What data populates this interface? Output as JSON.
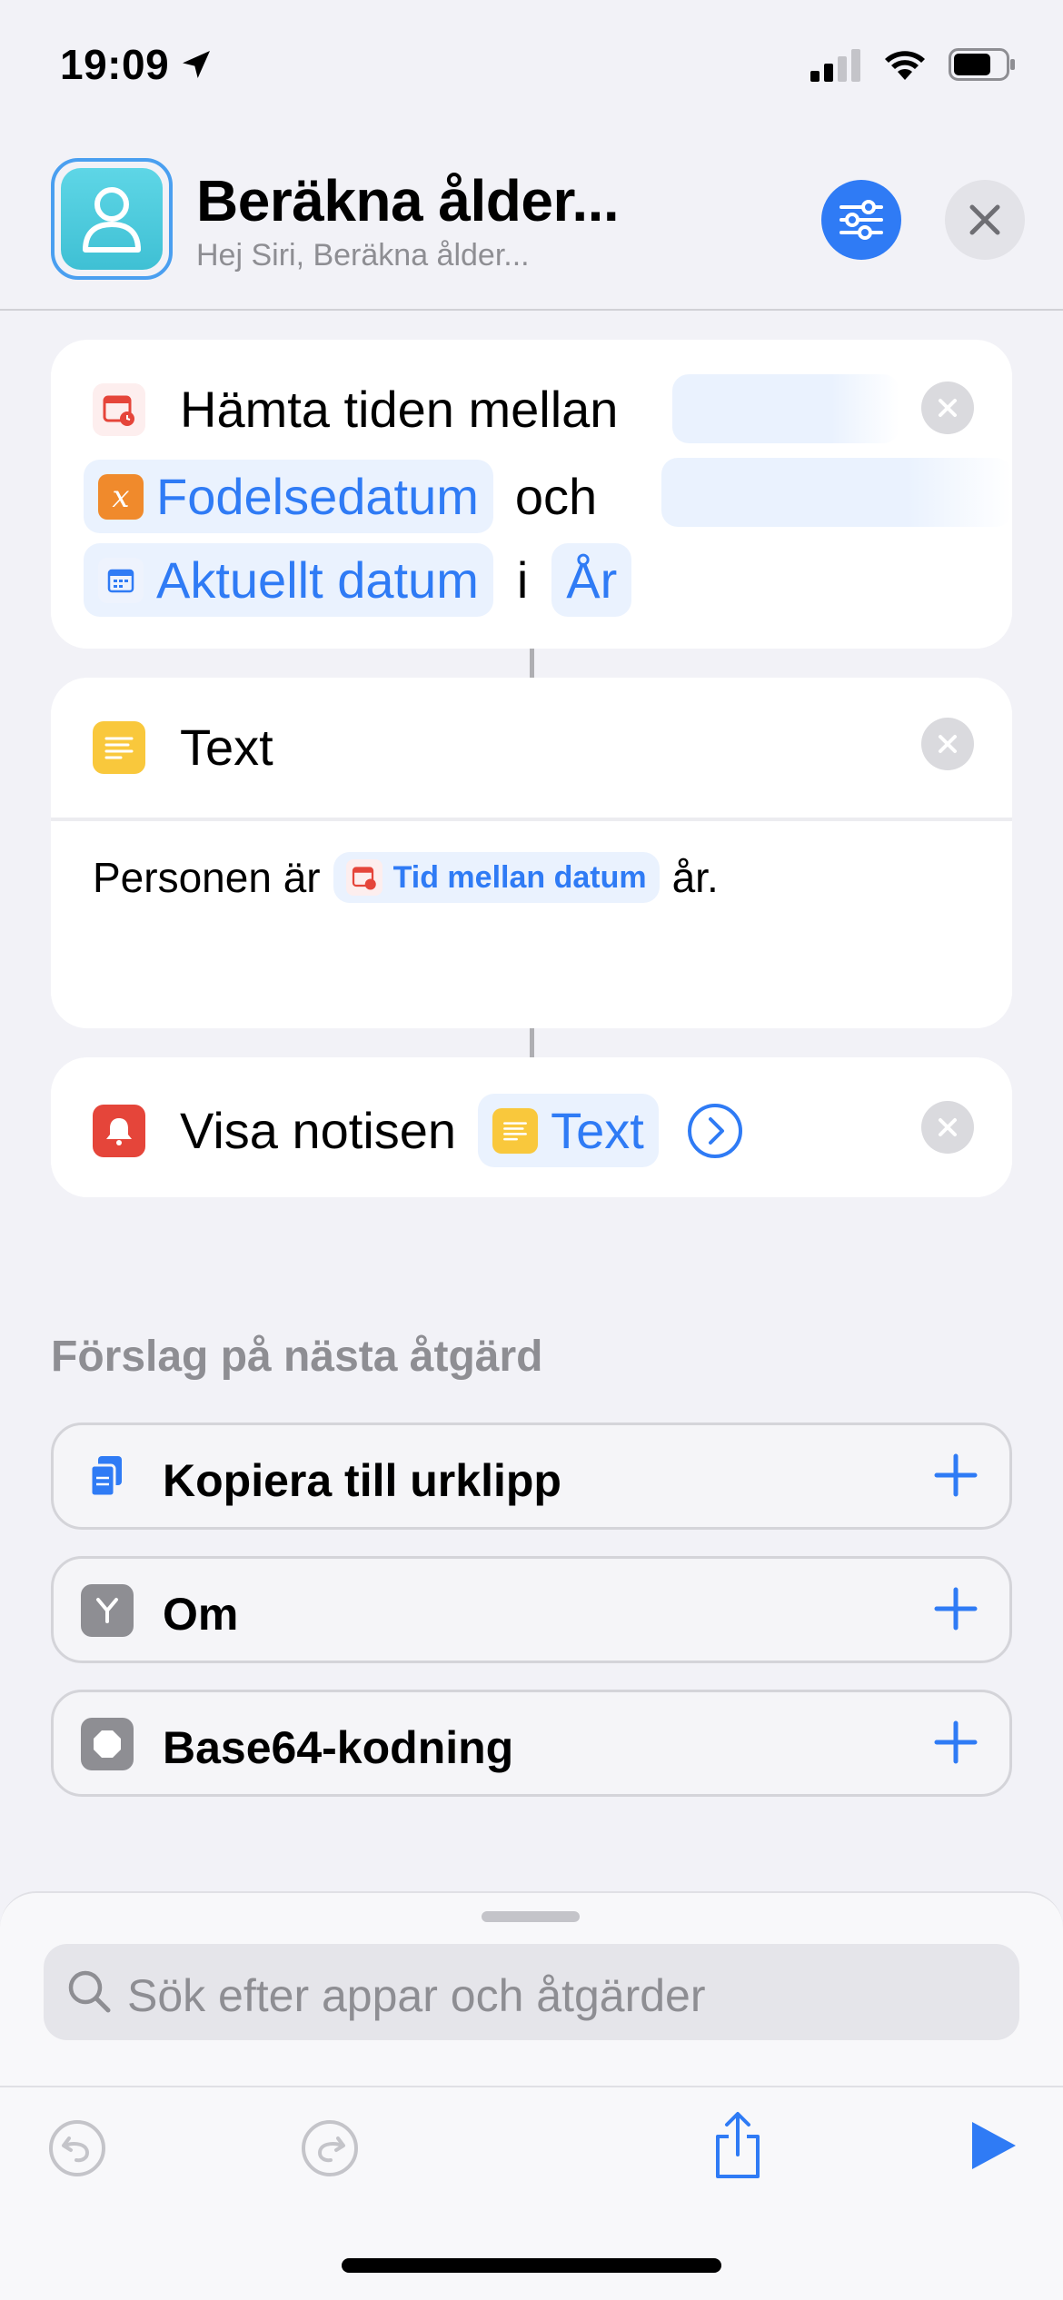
{
  "status_bar": {
    "time": "19:09"
  },
  "header": {
    "title": "Beräkna ålder...",
    "subtitle": "Hej Siri, Beräkna ålder..."
  },
  "actions": {
    "get_time": {
      "label": "Hämta tiden mellan",
      "token1": "Fodelsedatum",
      "connector_word": "och",
      "token2": "Aktuellt datum",
      "in_word": "i",
      "unit": "År"
    },
    "text": {
      "label": "Text",
      "content_prefix": "Personen är",
      "content_token": "Tid mellan datum",
      "content_suffix": "år."
    },
    "show_notification": {
      "label": "Visa notisen",
      "token": "Text"
    }
  },
  "suggestions": {
    "title": "Förslag på nästa åtgärd",
    "items": [
      {
        "label": "Kopiera till urklipp",
        "icon": "clipboard-icon"
      },
      {
        "label": "Om",
        "icon": "branch-icon"
      },
      {
        "label": "Base64-kodning",
        "icon": "octagon-icon"
      }
    ]
  },
  "search": {
    "placeholder": "Sök efter appar och åtgärder"
  },
  "colors": {
    "accent": "#2f7bf5",
    "background": "#f2f2f7"
  }
}
